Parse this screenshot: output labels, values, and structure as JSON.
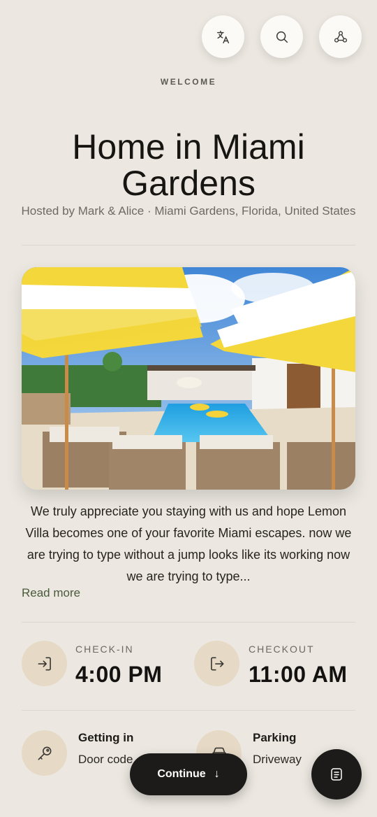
{
  "header": {
    "eyebrow": "WELCOME",
    "title": "Home in Miami Gardens",
    "subtitle": "Hosted by Mark & Alice · Miami Gardens, Florida, United States"
  },
  "top_buttons": [
    {
      "name": "translate-icon"
    },
    {
      "name": "search-icon"
    },
    {
      "name": "share-icon"
    }
  ],
  "hero": {
    "name": "villa-pool-photo"
  },
  "description": {
    "text": "We truly appreciate you staying with us and hope Lemon Villa becomes one of your favorite Miami escapes. now we are trying to type without a jump looks like its working now we are trying to type...",
    "read_more": "Read more"
  },
  "times": {
    "checkin_label": "CHECK-IN",
    "checkin_value": "4:00 PM",
    "checkout_label": "CHECKOUT",
    "checkout_value": "11:00 AM"
  },
  "info": {
    "getting_in_title": "Getting in",
    "getting_in_value": "Door code",
    "parking_title": "Parking",
    "parking_value": "Driveway"
  },
  "footer": {
    "continue_label": "Continue",
    "continue_arrow": "↓"
  },
  "colors": {
    "background": "#ece8e1",
    "accent_circle": "#e6dac6",
    "dark_button": "#1c1b19",
    "link_green": "#4a5a3b"
  }
}
